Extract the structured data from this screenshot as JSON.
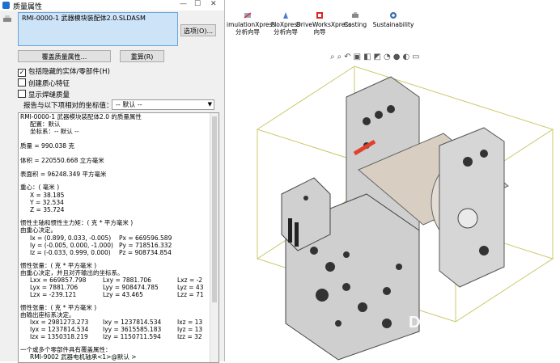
{
  "dialog": {
    "title": "质量属性",
    "selection": "RMI-0000-1 武器模块装配体2.0.SLDASM",
    "options_btn": "选项(O)...",
    "override_btn": "覆盖质量属性...",
    "recalc_btn": "重算(R)",
    "checks": [
      {
        "label": "包括隐藏的实体/零部件(H)",
        "checked": true
      },
      {
        "label": "创建质心特征",
        "checked": false
      },
      {
        "label": "显示焊缝质量",
        "checked": false
      }
    ],
    "coord_label": "报告与以下项相对的坐标值：",
    "coord_value": "-- 默认 --",
    "results": {
      "l1": "RMI-0000-1 武器模块装配体2.0 的质量属性",
      "l2": "配置：默认",
      "l3": "坐标系：-- 默认 --",
      "mass": "质量 = 990.038 克",
      "volume": "体积 = 220550.668 立方毫米",
      "area": "表面积 = 96248.349  平方毫米",
      "com_h": "重心：( 毫米 )",
      "cx": "X = 38.185",
      "cy": "Y = 32.534",
      "cz": "Z = 35.724",
      "pa_h": "惯性主轴和惯性主力矩：( 克 * 平方毫米 )",
      "pa_h2": "由重心决定。",
      "ix": "Ix = (0.899, 0.033, -0.005)",
      "px": "Px = 669596.589",
      "iy": "Iy = (-0.005, 0.000, -1.000)",
      "py": "Py = 718516.332",
      "iz": "Iz = (-0.033, 0.999, 0.000)",
      "pz": "Pz = 908734.854",
      "t1_h": "惯性张量：( 克 * 平方毫米 )",
      "t1_h2": "由重心决定，并且对齐输出的坐标系。",
      "lxx": "Lxx = 669857.798",
      "lxy": "Lxy = 7881.706",
      "lxz": "Lxz = -2",
      "lyx": "Lyx = 7881.706",
      "lyy": "Lyy = 908474.785",
      "lyz": "Lyz = 43",
      "lzx": "Lzx = -239.121",
      "lzy": "Lzy = 43.465",
      "lzz": "Lzz = 71",
      "t2_h": "惯性张量：( 克 * 平方毫米 )",
      "t2_h2": "由输出座标系决定。",
      "ixx": "Ixx = 2981273.273",
      "ixy": "Ixy = 1237814.534",
      "ixz": "Ixz = 13",
      "iyx": "Iyx = 1237814.534",
      "iyy": "Iyy = 3615585.183",
      "iyz": "Iyz = 13",
      "izx": "Izx = 1350318.219",
      "izy": "Izy = 1150711.594",
      "izz": "Izz = 32",
      "foot1": "一个或多个零部件具有覆盖属性：",
      "foot2": "RMI-9002 武器电机轴承<1>@默认 >"
    }
  },
  "toolbar": {
    "items": [
      {
        "l1": "imulationXpress",
        "l2": "分析向导",
        "icon": "simulation-icon"
      },
      {
        "l1": "FloXpress",
        "l2": "分析向导",
        "icon": "floxpress-icon"
      },
      {
        "l1": "DriveWorksXpress",
        "l2": "向导",
        "icon": "driveworks-icon"
      },
      {
        "l1": "Costing",
        "l2": "",
        "icon": "costing-icon"
      },
      {
        "l1": "Sustainability",
        "l2": "",
        "icon": "sustainability-icon"
      }
    ]
  },
  "watermark": "DF",
  "colors": {
    "accent": "#1f6fd1",
    "selection": "#cde3f7",
    "part": "#d9d9d9",
    "bbox": "#c8c86a"
  }
}
